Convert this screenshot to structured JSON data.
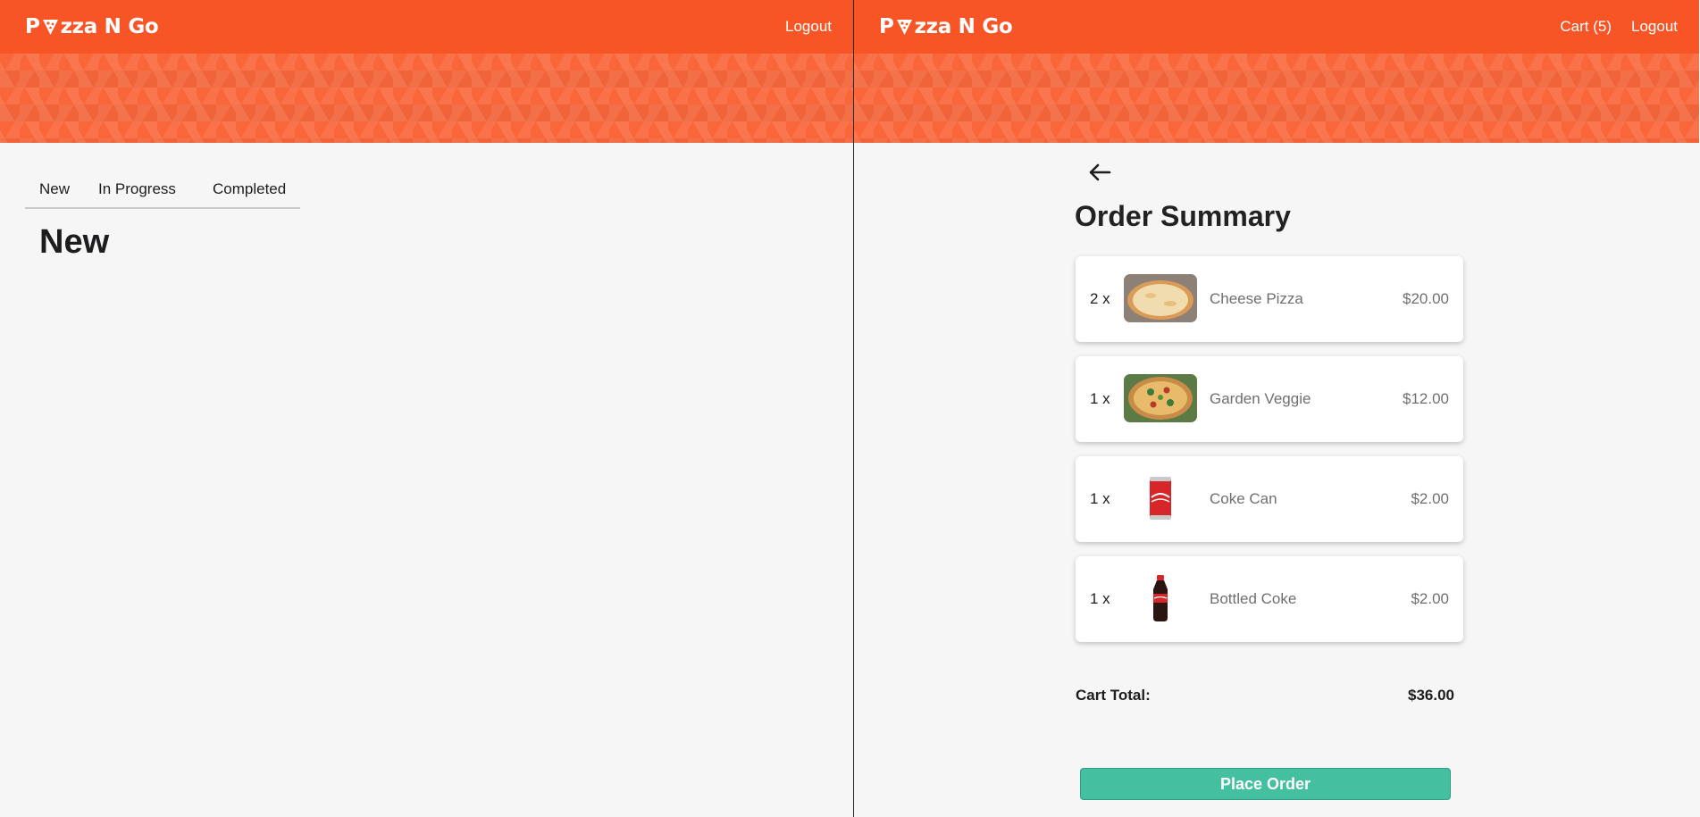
{
  "left": {
    "logo": {
      "before": "P",
      "after": "zza N Go"
    },
    "nav": {
      "logout": "Logout"
    },
    "tabs": [
      {
        "label": "New"
      },
      {
        "label": "In Progress"
      },
      {
        "label": "Completed"
      }
    ],
    "section_title": "New"
  },
  "right": {
    "logo": {
      "before": "P",
      "after": "zza N Go"
    },
    "nav": {
      "cart": "Cart (5)",
      "logout": "Logout"
    },
    "back_icon": "arrow-left-icon",
    "title": "Order Summary",
    "items": [
      {
        "qty": "2 x",
        "name": "Cheese Pizza",
        "price": "$20.00",
        "image": "cheese-pizza-image"
      },
      {
        "qty": "1 x",
        "name": "Garden Veggie",
        "price": "$12.00",
        "image": "garden-veggie-image"
      },
      {
        "qty": "1 x",
        "name": "Coke Can",
        "price": "$2.00",
        "image": "coke-can-image"
      },
      {
        "qty": "1 x",
        "name": "Bottled Coke",
        "price": "$2.00",
        "image": "bottled-coke-image"
      }
    ],
    "cart_total_label": "Cart Total:",
    "cart_total_value": "$36.00",
    "place_order": "Place Order"
  },
  "colors": {
    "brand": "#f85526",
    "banner": "#f9663a",
    "button": "#44bf9f",
    "background": "#f6f6f6"
  }
}
